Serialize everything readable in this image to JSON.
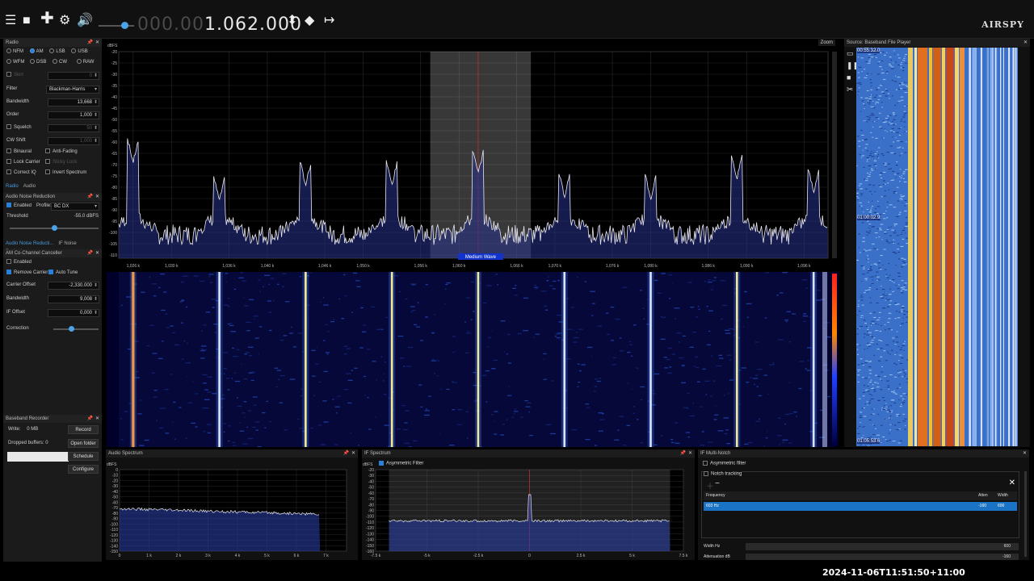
{
  "toolbar": {
    "frequency_dim": "000.00",
    "frequency_lit": "1.062.000",
    "logo": "AIRSPY"
  },
  "radio": {
    "title": "Radio",
    "modes": [
      "NFM",
      "AM",
      "LSB",
      "USB",
      "WFM",
      "DSB",
      "CW",
      "RAW"
    ],
    "selected_mode": "AM",
    "skirt_label": "Skirt",
    "skirt_value": "0",
    "filter_label": "Filter",
    "filter_value": "Blackman-Harris",
    "bandwidth_label": "Bandwidth",
    "bandwidth_value": "13,668",
    "order_label": "Order",
    "order_value": "1,000",
    "squelch_label": "Squelch",
    "squelch_value": "50",
    "cwshift_label": "CW Shift",
    "cwshift_value": "1,000",
    "binaural_label": "Binaural",
    "antifading_label": "Anti-Fading",
    "lockcarrier_label": "Lock Carrier",
    "stickylock_label": "Sticky Lock",
    "correctiq_label": "Correct IQ",
    "invert_label": "Invert Spectrum",
    "tab_radio": "Radio",
    "tab_audio": "Audio"
  },
  "noise_reduction": {
    "title": "Audio Noise Reduction",
    "enabled_label": "Enabled",
    "profile_label": "Profile:",
    "profile_value": "BC DX",
    "threshold_label": "Threshold",
    "threshold_value": "-55.0 dBFS",
    "threshold_level": 0.5,
    "tab_audio": "Audio Noise Reducti...",
    "tab_if": "IF Noise Reduction"
  },
  "cochannel": {
    "title": "AM Co-Channel Canceller",
    "enabled_label": "Enabled",
    "remove_carrier_label": "Remove Carrier",
    "auto_tune_label": "Auto Tune",
    "carrier_offset_label": "Carrier Offset",
    "carrier_offset_value": "-2,330.000",
    "bandwidth_label": "Bandwidth",
    "bandwidth_value": "9,008",
    "if_offset_label": "IF Offset",
    "if_offset_value": "0,000",
    "correction_label": "Correction",
    "correction_level": 0.4
  },
  "recorder": {
    "title": "Baseband Recorder",
    "write_label": "Write:",
    "write_value": "0 MB",
    "dropped_label": "Dropped buffers:",
    "dropped_value": "0",
    "record_btn": "Record",
    "open_btn": "Open folder",
    "schedule_btn": "Schedule",
    "configure_btn": "Configure"
  },
  "spectrum": {
    "zoom_label": "Zoom",
    "y_unit": "dBFS",
    "y_ticks": [
      "-20",
      "-25",
      "-30",
      "-35",
      "-40",
      "-45",
      "-50",
      "-55",
      "-60",
      "-65",
      "-70",
      "-75",
      "-80",
      "-85",
      "-90",
      "-95",
      "-100",
      "-105",
      "-110"
    ],
    "x_ticks": [
      "1,026 k",
      "1,030 k",
      "1,036 k",
      "1,040 k",
      "1,046 k",
      "1,050 k",
      "1,056 k",
      "1,060 k",
      "1,066 k",
      "1,070 k",
      "1,076 k",
      "1,080 k",
      "1,086 k",
      "1,090 k",
      "1,096 k"
    ],
    "band_label": "Medium Wave",
    "peaks_dbfs": [
      {
        "f_khz": 1026,
        "db": -69
      },
      {
        "f_khz": 1035,
        "db": -86
      },
      {
        "f_khz": 1044,
        "db": -79
      },
      {
        "f_khz": 1053,
        "db": -79
      },
      {
        "f_khz": 1062,
        "db": -74
      },
      {
        "f_khz": 1071,
        "db": -84
      },
      {
        "f_khz": 1080,
        "db": -85
      },
      {
        "f_khz": 1089,
        "db": -76
      },
      {
        "f_khz": 1097,
        "db": -82
      }
    ]
  },
  "file_player": {
    "title": "Source: Baseband File Player",
    "time_start": "00:55:32.0",
    "time_mid": "01:00:02.9",
    "time_end": "01:05:53.6"
  },
  "audio_spectrum": {
    "title": "Audio Spectrum",
    "y_unit": "dBFS",
    "y_ticks": [
      "0",
      "-10",
      "-20",
      "-30",
      "-40",
      "-50",
      "-60",
      "-70",
      "-80",
      "-90",
      "-100",
      "-110",
      "-120",
      "-130",
      "-140",
      "-150"
    ],
    "x_ticks": [
      "0",
      "1 k",
      "2 k",
      "3 k",
      "4 k",
      "5 k",
      "6 k",
      "7 k"
    ]
  },
  "if_spectrum": {
    "title": "IF Spectrum",
    "y_unit": "dBFS",
    "asym_label": "Asymmetric Filter",
    "y_ticks": [
      "-20",
      "-30",
      "-40",
      "-50",
      "-60",
      "-70",
      "-80",
      "-90",
      "-100",
      "-110",
      "-120",
      "-130",
      "-140",
      "-150",
      "-160"
    ],
    "x_ticks": [
      "-7.5 k",
      "-5 k",
      "-2.5 k",
      "0",
      "2.5 k",
      "5 k",
      "7.5 k"
    ]
  },
  "notch": {
    "title": "IF Multi-Notch",
    "asym_label": "Asymmetric filter",
    "tracking_label": "Notch tracking",
    "col_freq": "Frequency",
    "col_atten": "Atten",
    "col_width": "Width",
    "row_freq": "603 Hz",
    "row_atten": "-160",
    "row_width": "600",
    "width_label": "Width Hz",
    "width_value": "600",
    "atten_label": "Attenuation dB",
    "atten_value": "-160"
  },
  "status": {
    "timestamp": "2024-11-06T11:51:50+11:00"
  },
  "colors": {
    "accent": "#2a80d6",
    "fft_trace": "#e8e8f0",
    "waterfall_bg": "#00002a"
  }
}
